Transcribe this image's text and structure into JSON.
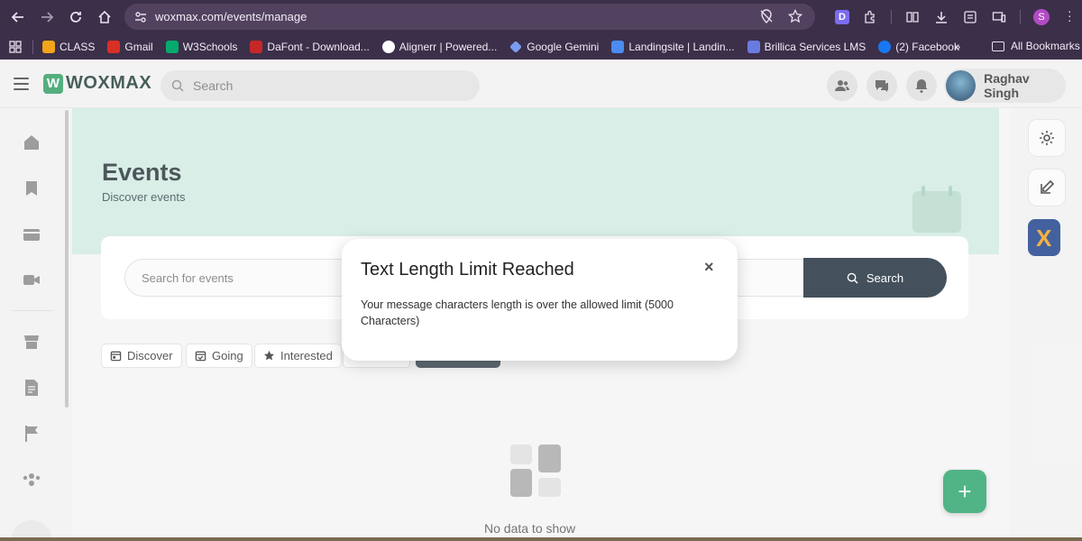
{
  "browser": {
    "url": "woxmax.com/events/manage",
    "profile_initial": "S",
    "extension_label": "D",
    "bookmarks": [
      {
        "label": "CLASS",
        "color": "#f2a51a"
      },
      {
        "label": "Gmail",
        "color": "#d93025"
      },
      {
        "label": "W3Schools",
        "color": "#04aa6d"
      },
      {
        "label": "DaFont - Download...",
        "color": "#c62828"
      },
      {
        "label": "Alignerr | Powered...",
        "color": "#ffffff"
      },
      {
        "label": "Google Gemini",
        "color": "#7a9cf0"
      },
      {
        "label": "Landingsite | Landin...",
        "color": "#4a8cf0"
      },
      {
        "label": "Brillica Services LMS",
        "color": "#6a7be0"
      },
      {
        "label": "(2) Facebook",
        "color": "#1877f2"
      }
    ],
    "more_label": "»",
    "all_bookmarks_label": "All Bookmarks"
  },
  "header": {
    "logo_mark": "W",
    "logo_text": "WOXMAX",
    "search_placeholder": "Search",
    "user_name": "Raghav Singh"
  },
  "main": {
    "title": "Events",
    "subtitle": "Discover events",
    "event_search_placeholder": "Search for events",
    "search_button_label": "Search",
    "tabs": [
      {
        "label": "Discover",
        "icon": "calendar-icon"
      },
      {
        "label": "Going",
        "icon": "calendar-check-icon"
      },
      {
        "label": "Interested",
        "icon": "star-icon"
      }
    ],
    "empty_text": "No data to show",
    "fab_label": "+"
  },
  "modal": {
    "title": "Text Length Limit Reached",
    "close_label": "×",
    "message": "Your message characters length is over the allowed limit (5000 Characters)"
  },
  "colors": {
    "chrome": "#3c2f4a",
    "hero": "#d0ebe1",
    "search_button": "#1c2b3a",
    "fab": "#2ba46d"
  }
}
